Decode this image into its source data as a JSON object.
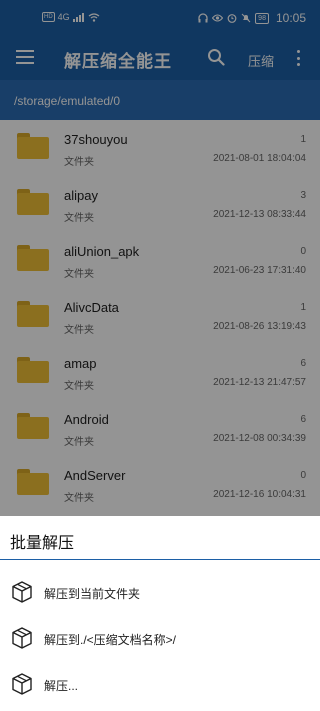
{
  "statusbar": {
    "net_badge": "HD",
    "signal_text": "4G",
    "battery": "98",
    "time": "10:05"
  },
  "appbar": {
    "title": "解压缩全能王",
    "compress_label": "压缩"
  },
  "path": "/storage/emulated/0",
  "files": [
    {
      "name": "37shouyou",
      "type": "文件夹",
      "count": "1",
      "date": "2021-08-01 18:04:04"
    },
    {
      "name": "alipay",
      "type": "文件夹",
      "count": "3",
      "date": "2021-12-13 08:33:44"
    },
    {
      "name": "aliUnion_apk",
      "type": "文件夹",
      "count": "0",
      "date": "2021-06-23 17:31:40"
    },
    {
      "name": "AlivcData",
      "type": "文件夹",
      "count": "1",
      "date": "2021-08-26 13:19:43"
    },
    {
      "name": "amap",
      "type": "文件夹",
      "count": "6",
      "date": "2021-12-13 21:47:57"
    },
    {
      "name": "Android",
      "type": "文件夹",
      "count": "6",
      "date": "2021-12-08 00:34:39"
    },
    {
      "name": "AndServer",
      "type": "文件夹",
      "count": "0",
      "date": "2021-12-16 10:04:31"
    }
  ],
  "sheet": {
    "title": "批量解压",
    "options": [
      {
        "label": "解压到当前文件夹"
      },
      {
        "label": "解压到./<压缩文档名称>/"
      },
      {
        "label": "解压..."
      }
    ]
  },
  "colors": {
    "primary": "#1c5fa6",
    "folder": "#f0c036"
  }
}
